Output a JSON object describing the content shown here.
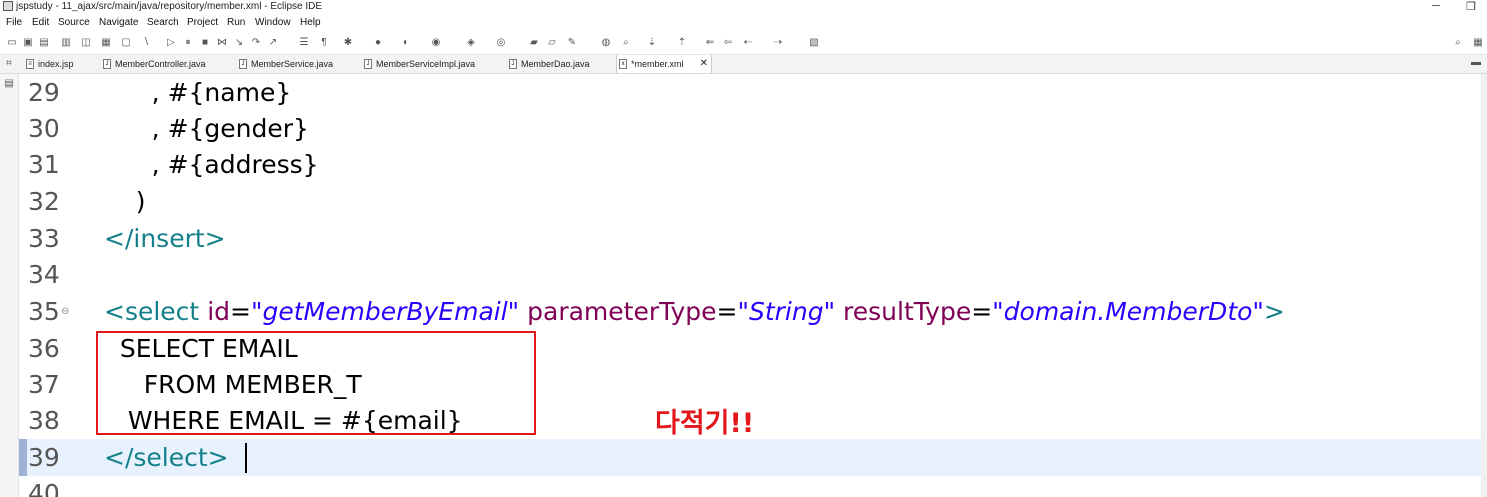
{
  "window": {
    "title": "jspstudy - 11_ajax/src/main/java/repository/member.xml - Eclipse IDE",
    "minimize_glyph": "─",
    "restore_glyph": "❐"
  },
  "menu": [
    "File",
    "Edit",
    "Source",
    "Navigate",
    "Search",
    "Project",
    "Run",
    "Window",
    "Help"
  ],
  "tabs": [
    {
      "label": "index.jsp",
      "icon": "jsp-file-icon",
      "icon_glyph": "≡"
    },
    {
      "label": "MemberController.java",
      "icon": "java-file-icon",
      "icon_glyph": "J"
    },
    {
      "label": "MemberService.java",
      "icon": "java-file-icon",
      "icon_glyph": "J"
    },
    {
      "label": "MemberServiceImpl.java",
      "icon": "java-file-icon",
      "icon_glyph": "J"
    },
    {
      "label": "MemberDao.java",
      "icon": "java-file-icon",
      "icon_glyph": "J"
    },
    {
      "label": "*member.xml",
      "icon": "xml-file-icon",
      "icon_glyph": "x",
      "close": "✕"
    }
  ],
  "editor": {
    "lines": {
      "l29": {
        "num": "29",
        "text": "      , #{name}"
      },
      "l30": {
        "num": "30",
        "text": "      , #{gender}"
      },
      "l31": {
        "num": "31",
        "text": "      , #{address}"
      },
      "l32": {
        "num": "32",
        "text": "    )"
      },
      "l33": {
        "num": "33",
        "open": "</",
        "tag": "insert",
        "close": ">"
      },
      "l34": {
        "num": "34"
      },
      "l35": {
        "num": "35",
        "open": "<",
        "tag": "select",
        "attr_id": "id",
        "eq1": "=",
        "val_id": "\"getMemberByEmail\"",
        "attr_param": "parameterType",
        "eq2": "=",
        "val_param": "\"String\"",
        "attr_result": "resultType",
        "eq3": "=",
        "val_result": "\"domain.MemberDto\"",
        "close": ">"
      },
      "l36": {
        "num": "36",
        "text": "  SELECT EMAIL"
      },
      "l37": {
        "num": "37",
        "text": "     FROM MEMBER_T"
      },
      "l38": {
        "num": "38",
        "text": "   WHERE EMAIL = #{email}"
      },
      "l39": {
        "num": "39",
        "open": "</",
        "tag": "select",
        "close": ">"
      },
      "l40": {
        "num": "40"
      }
    }
  },
  "annotation": {
    "text": "다적기!!",
    "color": "#e3161c"
  }
}
